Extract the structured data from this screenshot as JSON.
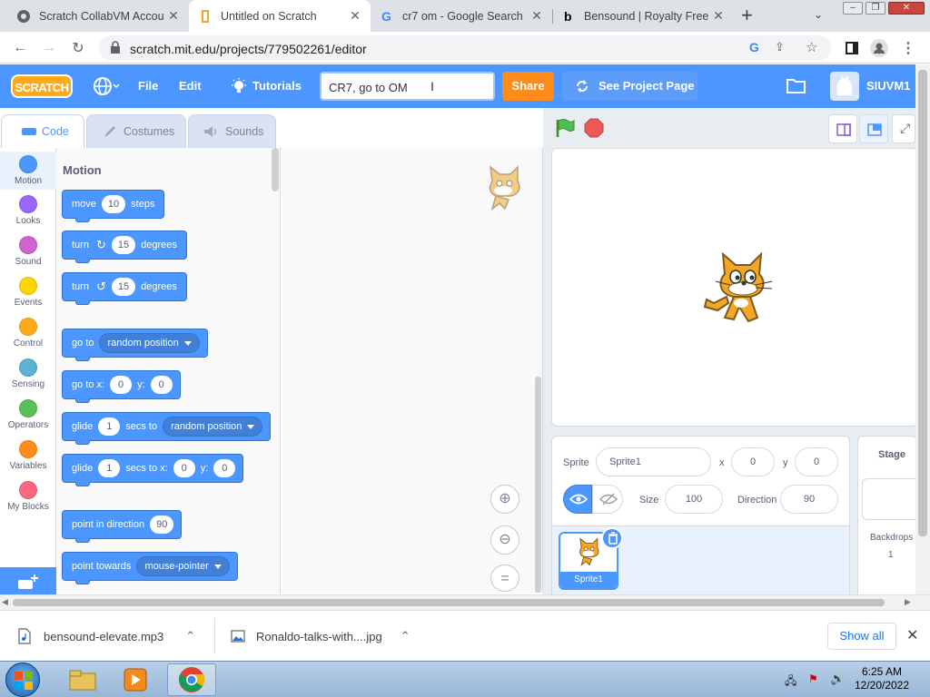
{
  "browser": {
    "tabs": [
      {
        "title": "Scratch CollabVM Accou",
        "active": false
      },
      {
        "title": "Untitled on Scratch",
        "active": true
      },
      {
        "title": "cr7 om - Google Search",
        "active": false
      },
      {
        "title": "Bensound | Royalty Free",
        "active": false
      }
    ],
    "url": "scratch.mit.edu/projects/779502261/editor"
  },
  "scratch": {
    "logo": "SCRATCH",
    "menu": {
      "file": "File",
      "edit": "Edit",
      "tutorials": "Tutorials"
    },
    "project_title": "CR7, go to OM",
    "share_label": "Share",
    "see_project_label": "See Project Page",
    "username": "SIUVM1",
    "editor_tabs": {
      "code": "Code",
      "costumes": "Costumes",
      "sounds": "Sounds"
    },
    "categories": [
      {
        "label": "Motion",
        "color": "#4c97ff"
      },
      {
        "label": "Looks",
        "color": "#9966ff"
      },
      {
        "label": "Sound",
        "color": "#cf63cf"
      },
      {
        "label": "Events",
        "color": "#ffd500"
      },
      {
        "label": "Control",
        "color": "#ffab19"
      },
      {
        "label": "Sensing",
        "color": "#5cb1d6"
      },
      {
        "label": "Operators",
        "color": "#59c059"
      },
      {
        "label": "Variables",
        "color": "#ff8c1a"
      },
      {
        "label": "My Blocks",
        "color": "#ff6680"
      }
    ],
    "palette_heading": "Motion",
    "blocks": {
      "move": {
        "a": "move",
        "v": "10",
        "b": "steps"
      },
      "turn_right": {
        "a": "turn",
        "v": "15",
        "b": "degrees"
      },
      "turn_left": {
        "a": "turn",
        "v": "15",
        "b": "degrees"
      },
      "goto": {
        "a": "go to",
        "menu": "random position"
      },
      "goto_xy": {
        "a": "go to x:",
        "x": "0",
        "b": "y:",
        "y": "0"
      },
      "glide": {
        "a": "glide",
        "v": "1",
        "b": "secs to",
        "menu": "random position"
      },
      "glide_xy": {
        "a": "glide",
        "v": "1",
        "b": "secs to x:",
        "x": "0",
        "c": "y:",
        "y": "0"
      },
      "point_dir": {
        "a": "point in direction",
        "v": "90"
      },
      "point_towards": {
        "a": "point towards",
        "menu": "mouse-pointer"
      }
    },
    "sprite_info": {
      "sprite_label": "Sprite",
      "sprite_name": "Sprite1",
      "x_label": "x",
      "x": "0",
      "y_label": "y",
      "y": "0",
      "size_label": "Size",
      "size": "100",
      "direction_label": "Direction",
      "direction": "90"
    },
    "sprite_thumb_label": "Sprite1",
    "stage_pane": {
      "title": "Stage",
      "backdrops_label": "Backdrops",
      "backdrops_count": "1"
    }
  },
  "downloads": {
    "items": [
      {
        "name": "bensound-elevate.mp3"
      },
      {
        "name": "Ronaldo-talks-with....jpg"
      }
    ],
    "show_all": "Show all"
  },
  "taskbar": {
    "time": "6:25 AM",
    "date": "12/20/2022"
  }
}
